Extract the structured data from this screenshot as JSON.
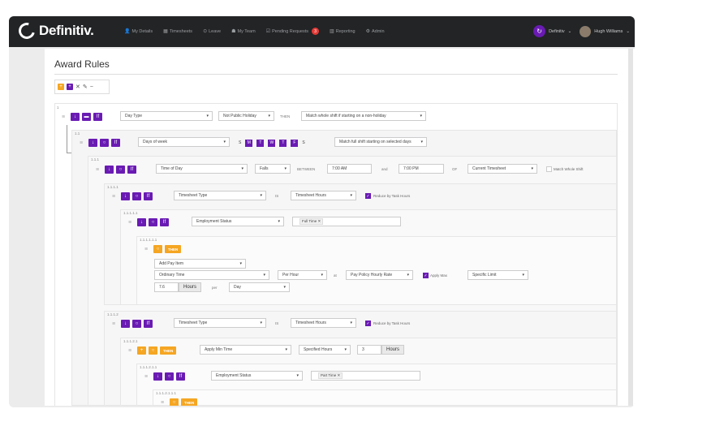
{
  "app": {
    "brand": "Definitiv."
  },
  "nav": {
    "items": [
      {
        "icon": "user-icon",
        "glyph": "👤",
        "label": "My Details"
      },
      {
        "icon": "calendar-icon",
        "glyph": "▦",
        "label": "Timesheets"
      },
      {
        "icon": "leave-icon",
        "glyph": "⊙",
        "label": "Leave"
      },
      {
        "icon": "team-icon",
        "glyph": "☗",
        "label": "My Team"
      },
      {
        "icon": "requests-icon",
        "glyph": "☑",
        "label": "Pending Requests",
        "badge": "3"
      },
      {
        "icon": "reporting-icon",
        "glyph": "▥",
        "label": "Reporting"
      },
      {
        "icon": "admin-icon",
        "glyph": "⚙",
        "label": "Admin"
      }
    ],
    "org": "Definitiv",
    "user": "Hugh Williams",
    "chevron": "⌄"
  },
  "page": {
    "title": "Award Rules"
  },
  "toolbar": {
    "expand": "+",
    "add": "+",
    "collapse": "✕",
    "edit": "✎",
    "remove": "−"
  },
  "tree": {
    "n1": {
      "number": "1",
      "field": "Day Type",
      "value": "Not Public Holiday",
      "then": "THEN",
      "action": "Match whole shift if starting on a non-holiday"
    },
    "n11": {
      "number": "1.1",
      "field": "Days of week",
      "days": [
        "S",
        "M",
        "T",
        "W",
        "T",
        "F",
        "S"
      ],
      "action": "Match full shift starting on selected days"
    },
    "n111": {
      "number": "1.1.1",
      "field": "Time of Day",
      "op": "Falls",
      "between": "BETWEEN",
      "from": "7:00 AM",
      "and": "and",
      "to": "7:00 PM",
      "of": "OF",
      "source": "Current Timesheet",
      "check_label": "Match Whole Shift"
    },
    "n1111": {
      "number": "1.1.1.1",
      "field": "Timesheet Type",
      "is": "IS",
      "value": "Timesheet Hours",
      "check_label": "Reduce by Task Hours"
    },
    "n11111": {
      "number": "1.1.1.1.1",
      "field": "Employment Status",
      "tag": "Full Time"
    },
    "n111111": {
      "number": "1.1.1.1.1.1",
      "then": "THEN",
      "add": "Add Pay Item",
      "pay_item": "Ordinary Time",
      "per": "Per Hour",
      "at": "at",
      "rate": "Pay Policy Hourly Rate",
      "apply_max": "Apply Max",
      "limit": "Specific Limit",
      "qty": "7.6",
      "unit": "Hours",
      "per_label": "per",
      "period": "Day"
    },
    "n1112": {
      "number": "1.1.1.2",
      "field": "Timesheet Type",
      "is": "IS",
      "value": "Timesheet Hours",
      "check_label": "Reduce by Task Hours"
    },
    "n11121": {
      "number": "1.1.1.2.1",
      "then": "THEN",
      "action": "Apply Min Time",
      "mode": "Specified Hours",
      "qty": "3",
      "unit": "Hours"
    },
    "n111211": {
      "number": "1.1.1.2.1.1",
      "field": "Employment Status",
      "tag": "Part Time"
    },
    "n1112111": {
      "number": "1.1.1.2.1.1.1",
      "then": "THEN"
    }
  },
  "colors": {
    "purple": "#6a1bb3",
    "orange": "#f5a623",
    "topbar": "#222426"
  }
}
